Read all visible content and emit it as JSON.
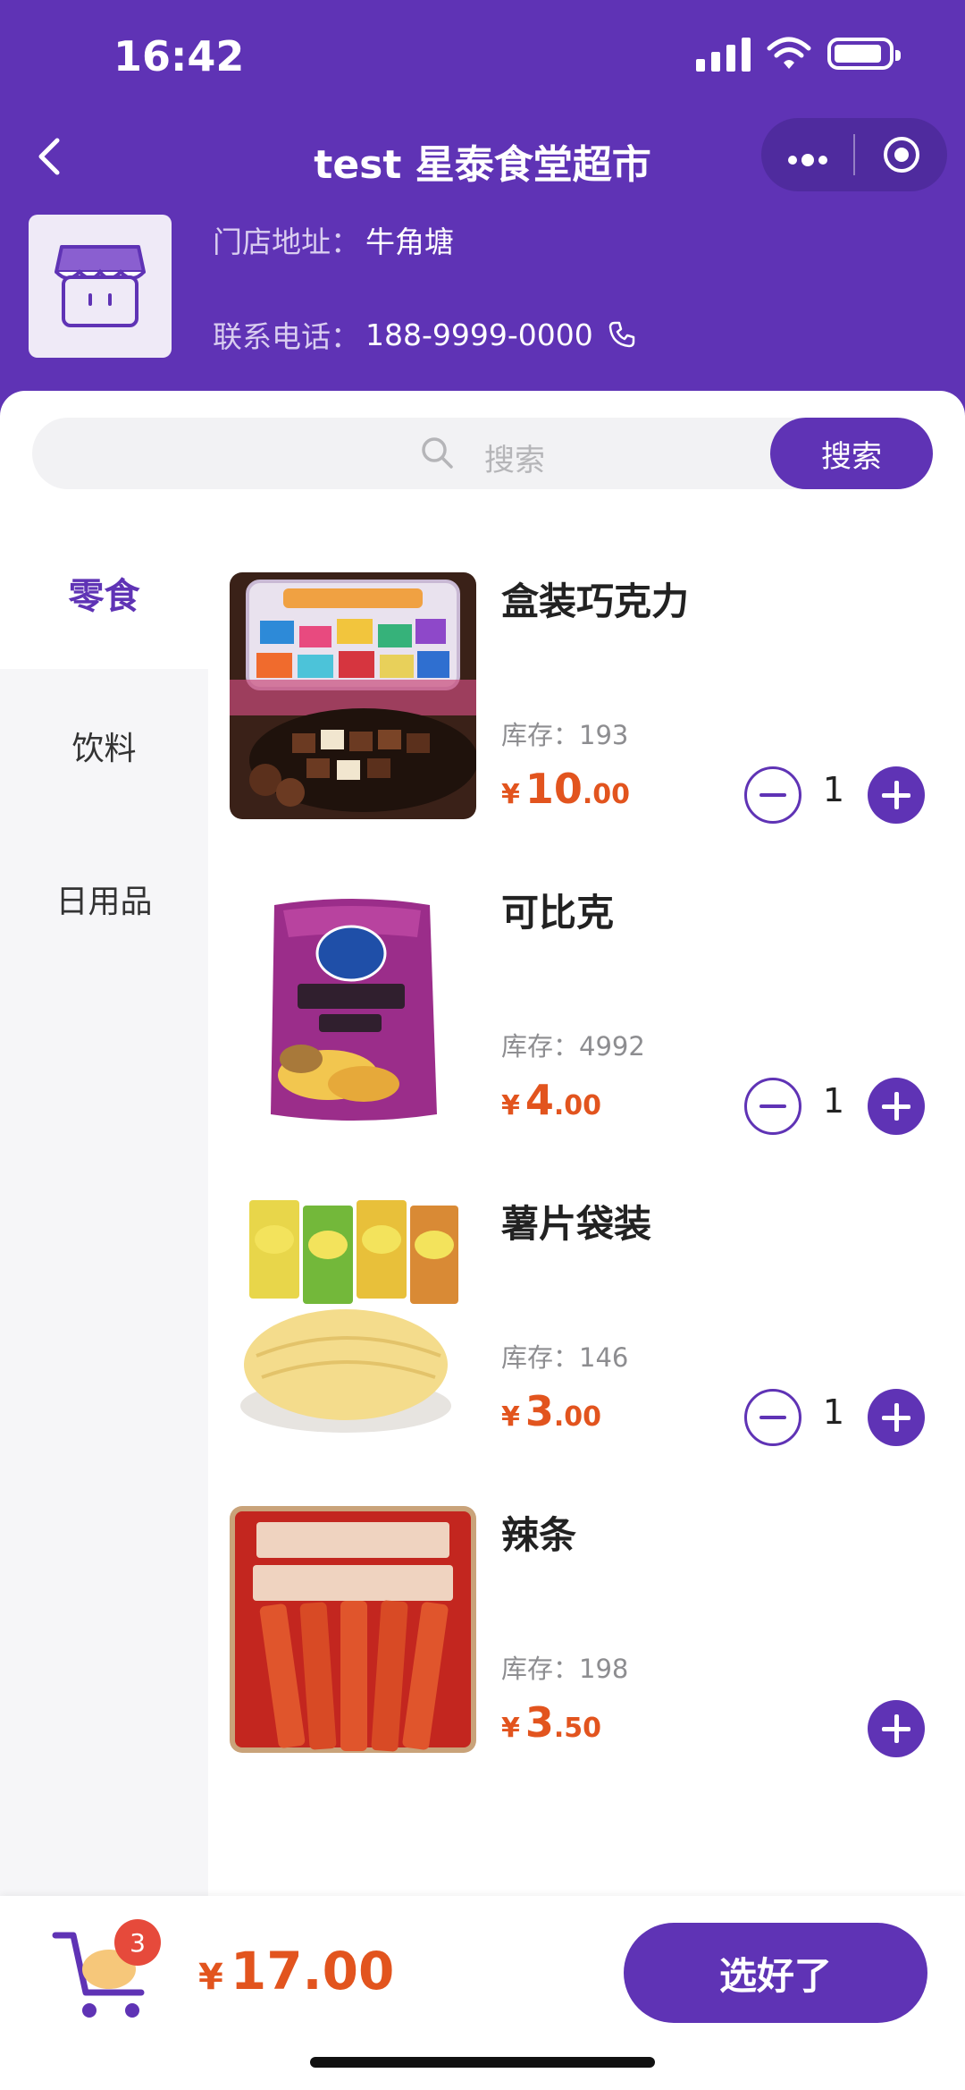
{
  "status_bar": {
    "time": "16:42"
  },
  "nav": {
    "title": "test 星泰食堂超市",
    "more_icon": "more-dots-icon",
    "close_icon": "target-circle-icon"
  },
  "store": {
    "address_label": "门店地址：",
    "address": "牛角塘",
    "phone_label": "联系电话：",
    "phone": "188-9999-0000"
  },
  "search": {
    "placeholder": "搜索",
    "button_label": "搜索"
  },
  "categories": [
    {
      "label": "零食",
      "active": true
    },
    {
      "label": "饮料",
      "active": false
    },
    {
      "label": "日用品",
      "active": false
    }
  ],
  "products": [
    {
      "name": "盒装巧克力",
      "stock_label": "库存：193",
      "price_yen": "¥",
      "price_int": "10",
      "price_dec": ".00",
      "qty": "1"
    },
    {
      "name": "可比克",
      "stock_label": "库存：4992",
      "price_yen": "¥",
      "price_int": "4",
      "price_dec": ".00",
      "qty": "1"
    },
    {
      "name": "薯片袋装",
      "stock_label": "库存：146",
      "price_yen": "¥",
      "price_int": "3",
      "price_dec": ".00",
      "qty": "1"
    },
    {
      "name": "辣条",
      "stock_label": "库存：198",
      "price_yen": "¥",
      "price_int": "3",
      "price_dec": ".50",
      "qty": ""
    }
  ],
  "cart": {
    "badge_count": "3",
    "total_yen": "¥",
    "total": "17.00",
    "confirm_label": "选好了"
  },
  "colors": {
    "brand": "#5f33b5",
    "price": "#e2541e",
    "badge": "#e64a3b"
  }
}
